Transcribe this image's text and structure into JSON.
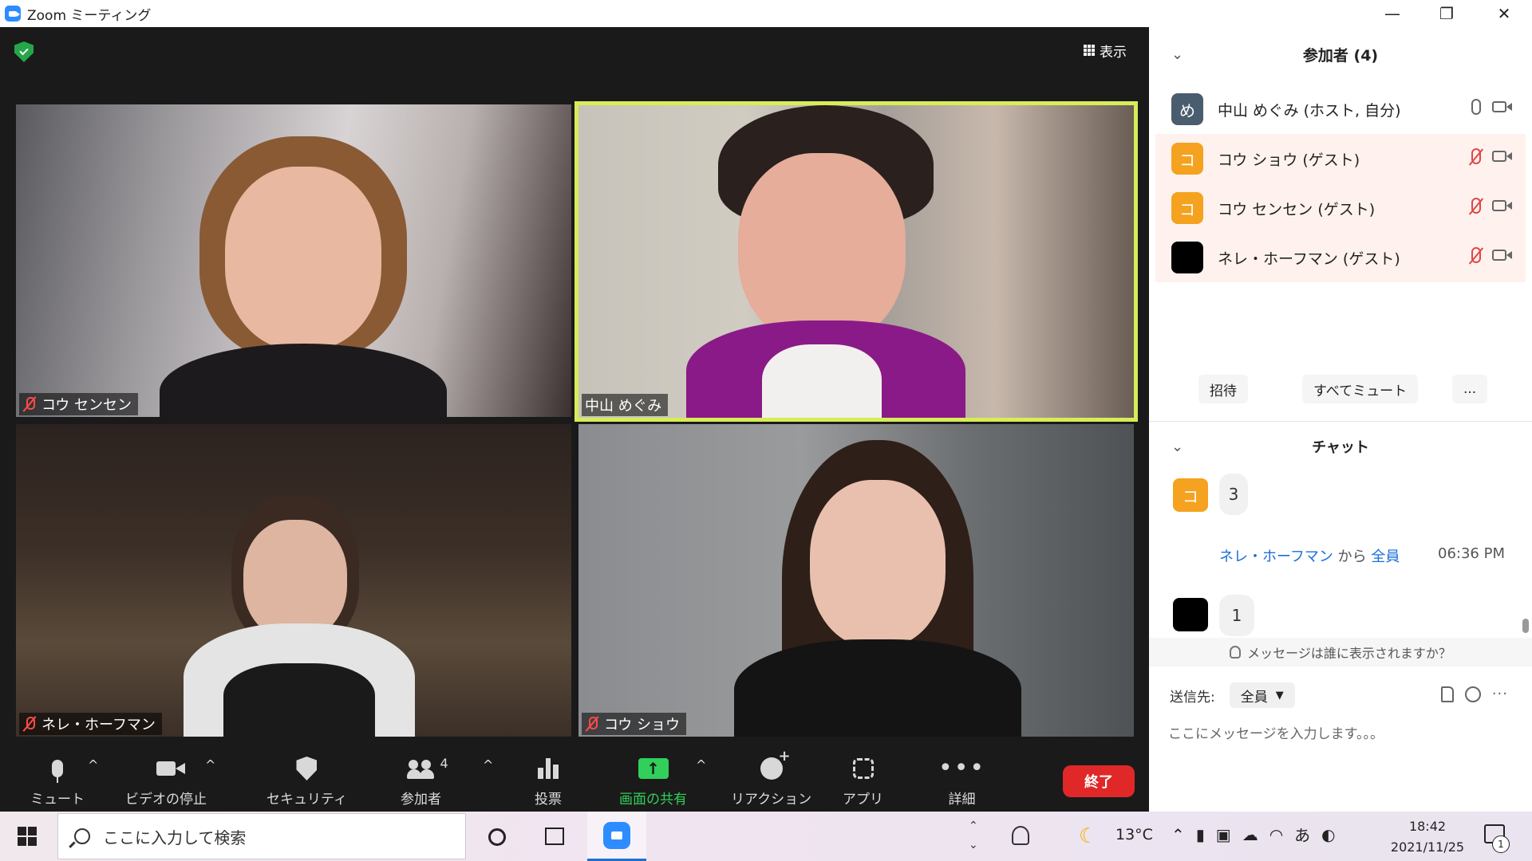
{
  "window": {
    "title": "Zoom ミーティング"
  },
  "video": {
    "view_label": "表示",
    "tiles": [
      {
        "name": "コウ センセン",
        "muted": true
      },
      {
        "name": "中山 めぐみ",
        "muted": false,
        "active_speaker": true
      },
      {
        "name": "ネレ・ホーフマン",
        "muted": true
      },
      {
        "name": "コウ ショウ",
        "muted": true
      }
    ]
  },
  "toolbar": {
    "mute": "ミュート",
    "stop_video": "ビデオの停止",
    "security": "セキュリティ",
    "participants": "参加者",
    "participants_count": "4",
    "polls": "投票",
    "share": "画面の共有",
    "reactions": "リアクション",
    "apps": "アプリ",
    "more": "詳細",
    "end": "終了"
  },
  "participants_panel": {
    "title": "参加者 (4)",
    "participants": [
      {
        "initial": "め",
        "name": "中山 めぐみ (ホスト, 自分)",
        "avatar_color": "#4a5d6e",
        "mic_muted": false,
        "guest": false
      },
      {
        "initial": "コ",
        "name": "コウ ショウ (ゲスト)",
        "avatar_color": "#f4a21f",
        "mic_muted": true,
        "guest": true
      },
      {
        "initial": "コ",
        "name": "コウ センセン (ゲスト)",
        "avatar_color": "#f4a21f",
        "mic_muted": true,
        "guest": true
      },
      {
        "initial": "",
        "name": "ネレ・ホーフマン (ゲスト)",
        "avatar_color": "#000000",
        "mic_muted": true,
        "guest": true
      }
    ],
    "invite": "招待",
    "mute_all": "すべてミュート",
    "more": "..."
  },
  "chat": {
    "title": "チャット",
    "messages": [
      {
        "initial": "コ",
        "text": "3"
      },
      {
        "sender": "ネレ・ホーフマン",
        "from_word": "から",
        "to": "全員",
        "time": "06:36 PM",
        "text": "1"
      }
    ],
    "who_can_see": "メッセージは誰に表示されますか？",
    "send_to_label": "送信先:",
    "send_to_value": "全員",
    "input_placeholder": "ここにメッセージを入力します。。。"
  },
  "taskbar": {
    "search_placeholder": "ここに入力して検索",
    "temperature": "13°C",
    "ime": "あ",
    "time": "18:42",
    "date": "2021/11/25",
    "notification_count": "1"
  },
  "colors": {
    "share_green": "#31d05a",
    "end_red": "#e02828",
    "zoom_blue": "#2d8cff",
    "speaker_border": "#d7ec58",
    "guest_row": "#fff2ee"
  }
}
